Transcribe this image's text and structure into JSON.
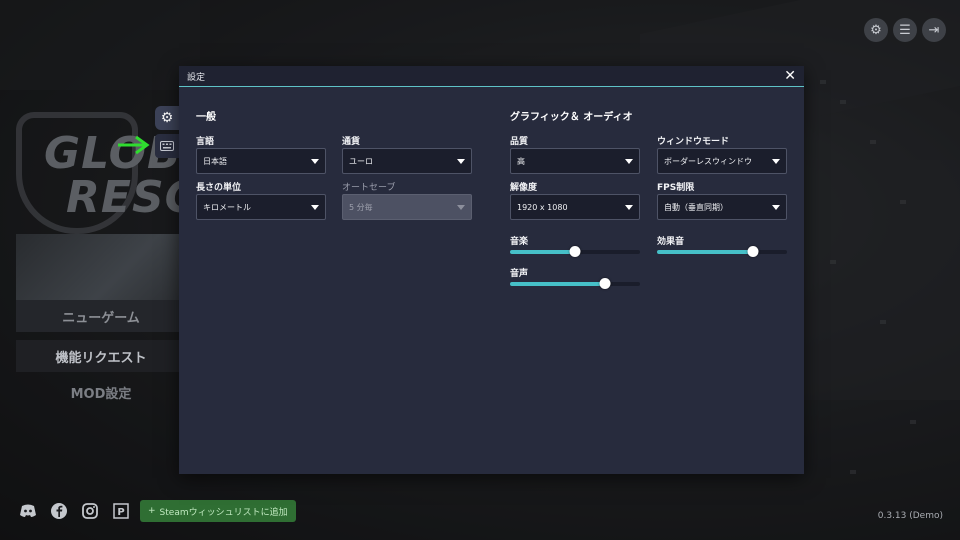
{
  "background_menu": {
    "logo_line1": "GLOB",
    "logo_line2": "RESC",
    "items": [
      "ニューゲーム",
      "機能リクエスト",
      "MOD設定"
    ]
  },
  "top_right_buttons": [
    "gear-icon",
    "list-icon",
    "exit-icon"
  ],
  "bottom_bar": {
    "wishlist_label": "Steamウィッシュリストに追加",
    "version": "0.3.13 (Demo)"
  },
  "dialog": {
    "title": "設定",
    "close_glyph": "✕",
    "general": {
      "heading": "一般",
      "fields": [
        {
          "label": "言語",
          "value": "日本語",
          "disabled": false
        },
        {
          "label": "通貨",
          "value": "ユーロ",
          "disabled": false
        },
        {
          "label": "長さの単位",
          "value": "キロメートル",
          "disabled": false
        },
        {
          "label": "オートセーブ",
          "value": "5 分毎",
          "disabled": true
        }
      ]
    },
    "graphics": {
      "heading": "グラフィック＆ オーディオ",
      "fields": [
        {
          "label": "品質",
          "value": "高"
        },
        {
          "label": "ウィンドウモード",
          "value": "ボーダーレスウィンドウ"
        },
        {
          "label": "解像度",
          "value": "1920 x 1080"
        },
        {
          "label": "FPS制限",
          "value": "自動（垂直同期）"
        }
      ],
      "sliders": [
        {
          "label": "音楽",
          "value": 0.5
        },
        {
          "label": "効果音",
          "value": 0.74
        },
        {
          "label": "音声",
          "value": 0.73
        }
      ]
    }
  },
  "colors": {
    "accent": "#46c0c8",
    "arrow": "#2fdc2f",
    "dialog_bg": "#272b3d"
  }
}
